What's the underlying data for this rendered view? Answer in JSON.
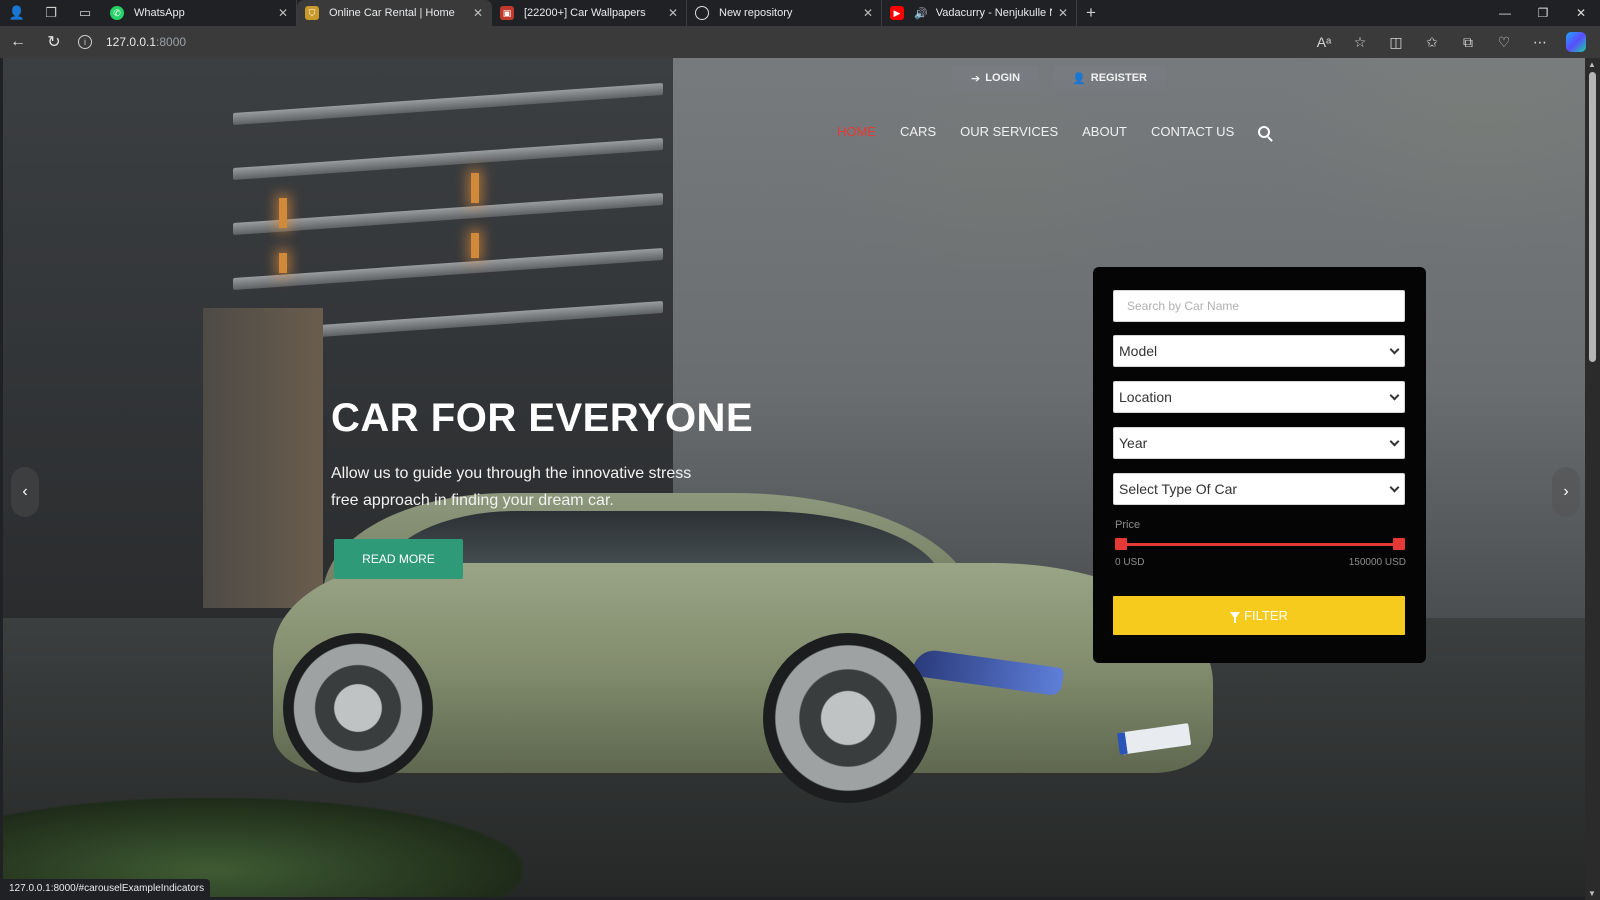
{
  "browser": {
    "tabs": [
      {
        "title": "WhatsApp",
        "icon": "whatsapp-icon",
        "color": "#25D366",
        "active": false
      },
      {
        "title": "Online Car Rental | Home",
        "icon": "site-favicon",
        "color": "#c89a2c",
        "active": true
      },
      {
        "title": "[22200+] Car Wallpapers",
        "icon": "wallpapers-favicon",
        "color": "#c0392b",
        "active": false
      },
      {
        "title": "New repository",
        "icon": "github-icon",
        "color": "#ffffff",
        "active": false
      },
      {
        "title": "Vadacurry - Nenjukulle Nee",
        "icon": "youtube-icon",
        "color": "#ff0000",
        "active": false
      }
    ],
    "url_host": "127.0.0.1",
    "url_port": ":8000",
    "status_url": "127.0.0.1:8000/#carouselExampleIndicators"
  },
  "site": {
    "auth": {
      "login": "LOGIN",
      "register": "REGISTER"
    },
    "nav": [
      "HOME",
      "CARS",
      "OUR SERVICES",
      "ABOUT",
      "CONTACT US"
    ],
    "active_nav": "HOME",
    "accent_color": "#e53935"
  },
  "hero": {
    "title": "CAR FOR EVERYONE",
    "text": "Allow us to guide you through the innovative stress free approach in finding your dream car.",
    "button": "READ MORE",
    "button_color": "#2f9a78"
  },
  "filter": {
    "search_placeholder": "Search by Car Name",
    "selects": [
      "Model",
      "Location",
      "Year",
      "Select Type Of Car"
    ],
    "price_label": "Price",
    "price_min": "0 USD",
    "price_max": "150000 USD",
    "button": "FILTER",
    "button_color": "#f6cb1e"
  }
}
